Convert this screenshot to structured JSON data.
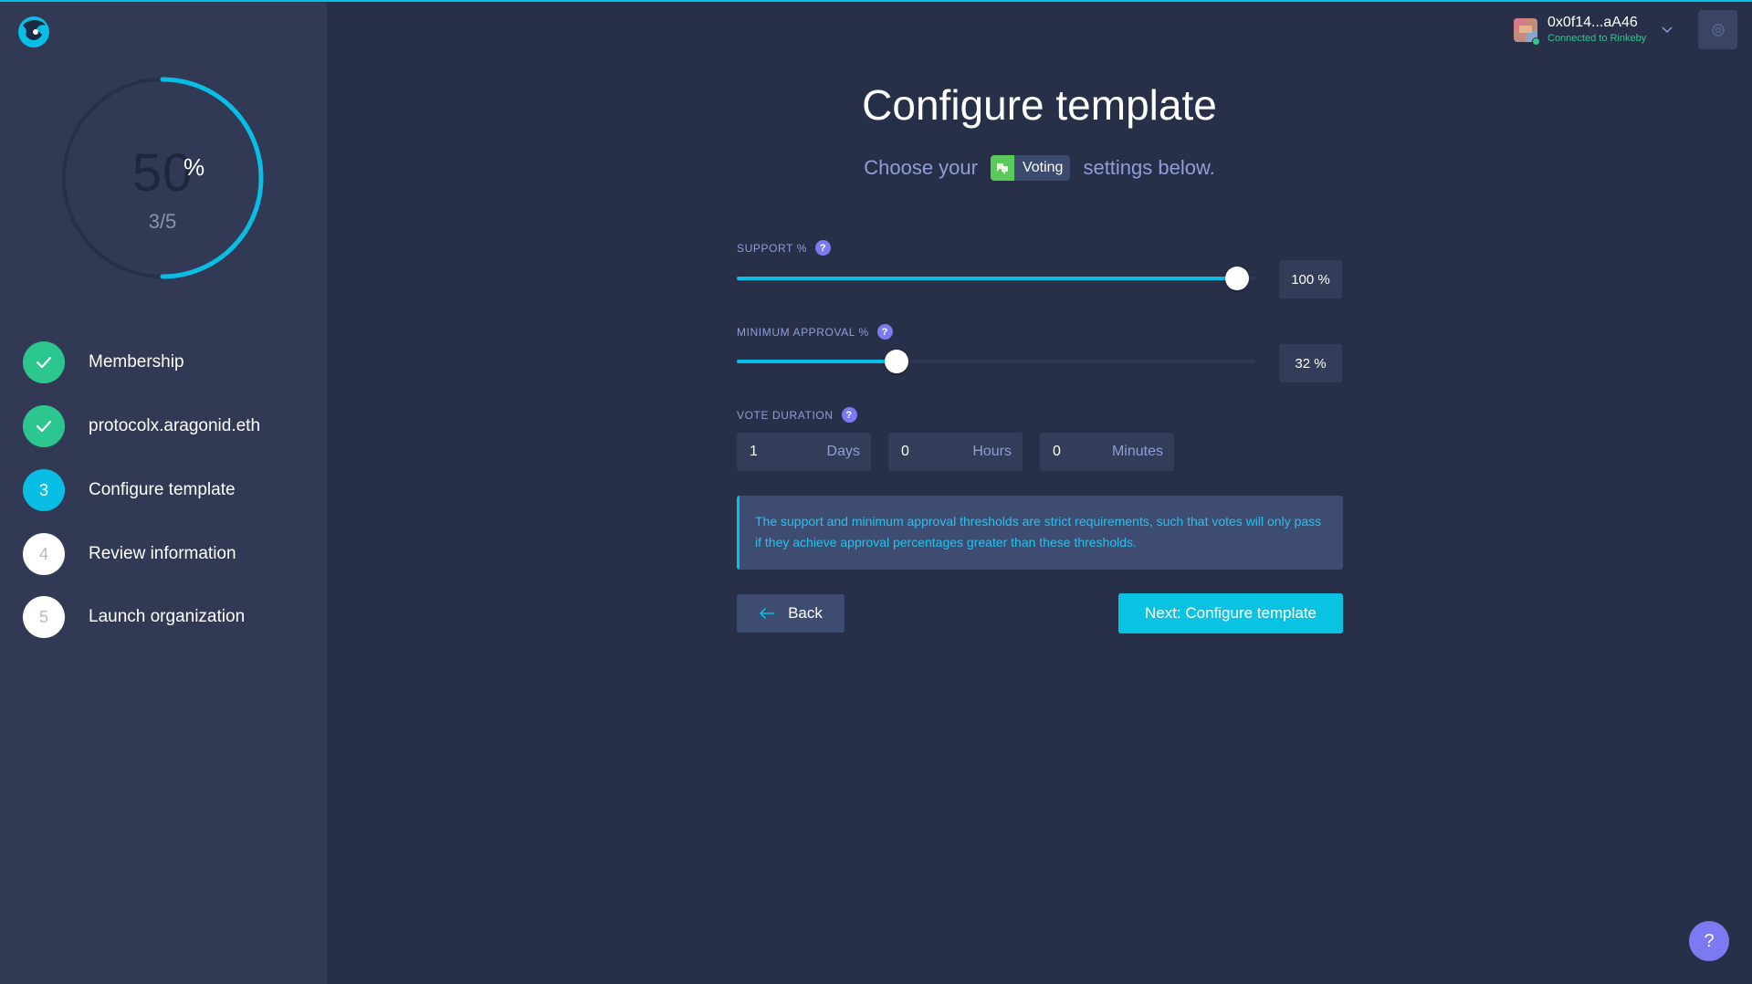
{
  "sidebar": {
    "progress": {
      "percent_value": "50",
      "percent_sign": "%",
      "fraction": "3/5",
      "completed_fraction": 0.5
    },
    "steps": [
      {
        "marker": "",
        "label": "Membership",
        "state": "done"
      },
      {
        "marker": "",
        "label": "protocolx.aragonid.eth",
        "state": "done"
      },
      {
        "marker": "3",
        "label": "Configure template",
        "state": "active"
      },
      {
        "marker": "4",
        "label": "Review information",
        "state": "pending"
      },
      {
        "marker": "5",
        "label": "Launch organization",
        "state": "pending"
      }
    ]
  },
  "header": {
    "account_address": "0x0f14...aA46",
    "network_status": "Connected to Rinkeby"
  },
  "main": {
    "title": "Configure template",
    "subtitle_before": "Choose your",
    "app_badge": "Voting",
    "subtitle_after": "settings below.",
    "support": {
      "label": "SUPPORT %",
      "help": "?",
      "value_text": "100 %",
      "value": 100
    },
    "min_approval": {
      "label": "MINIMUM APPROVAL %",
      "help": "?",
      "value_text": "32 %",
      "value": 32
    },
    "vote_duration": {
      "label": "VOTE DURATION",
      "help": "?",
      "days_value": "1",
      "days_unit": "Days",
      "hours_value": "0",
      "hours_unit": "Hours",
      "minutes_value": "0",
      "minutes_unit": "Minutes"
    },
    "info_text": "The support and minimum approval thresholds are strict requirements, such that votes will only pass if they achieve approval percentages greater than these thresholds.",
    "back_label": "Back",
    "next_label": "Next: Configure template"
  },
  "help_fab": "?",
  "colors": {
    "accent": "#08bee5",
    "success": "#2cc68f",
    "help": "#7c79f1",
    "background": "#283049",
    "sidebar": "#313955"
  }
}
